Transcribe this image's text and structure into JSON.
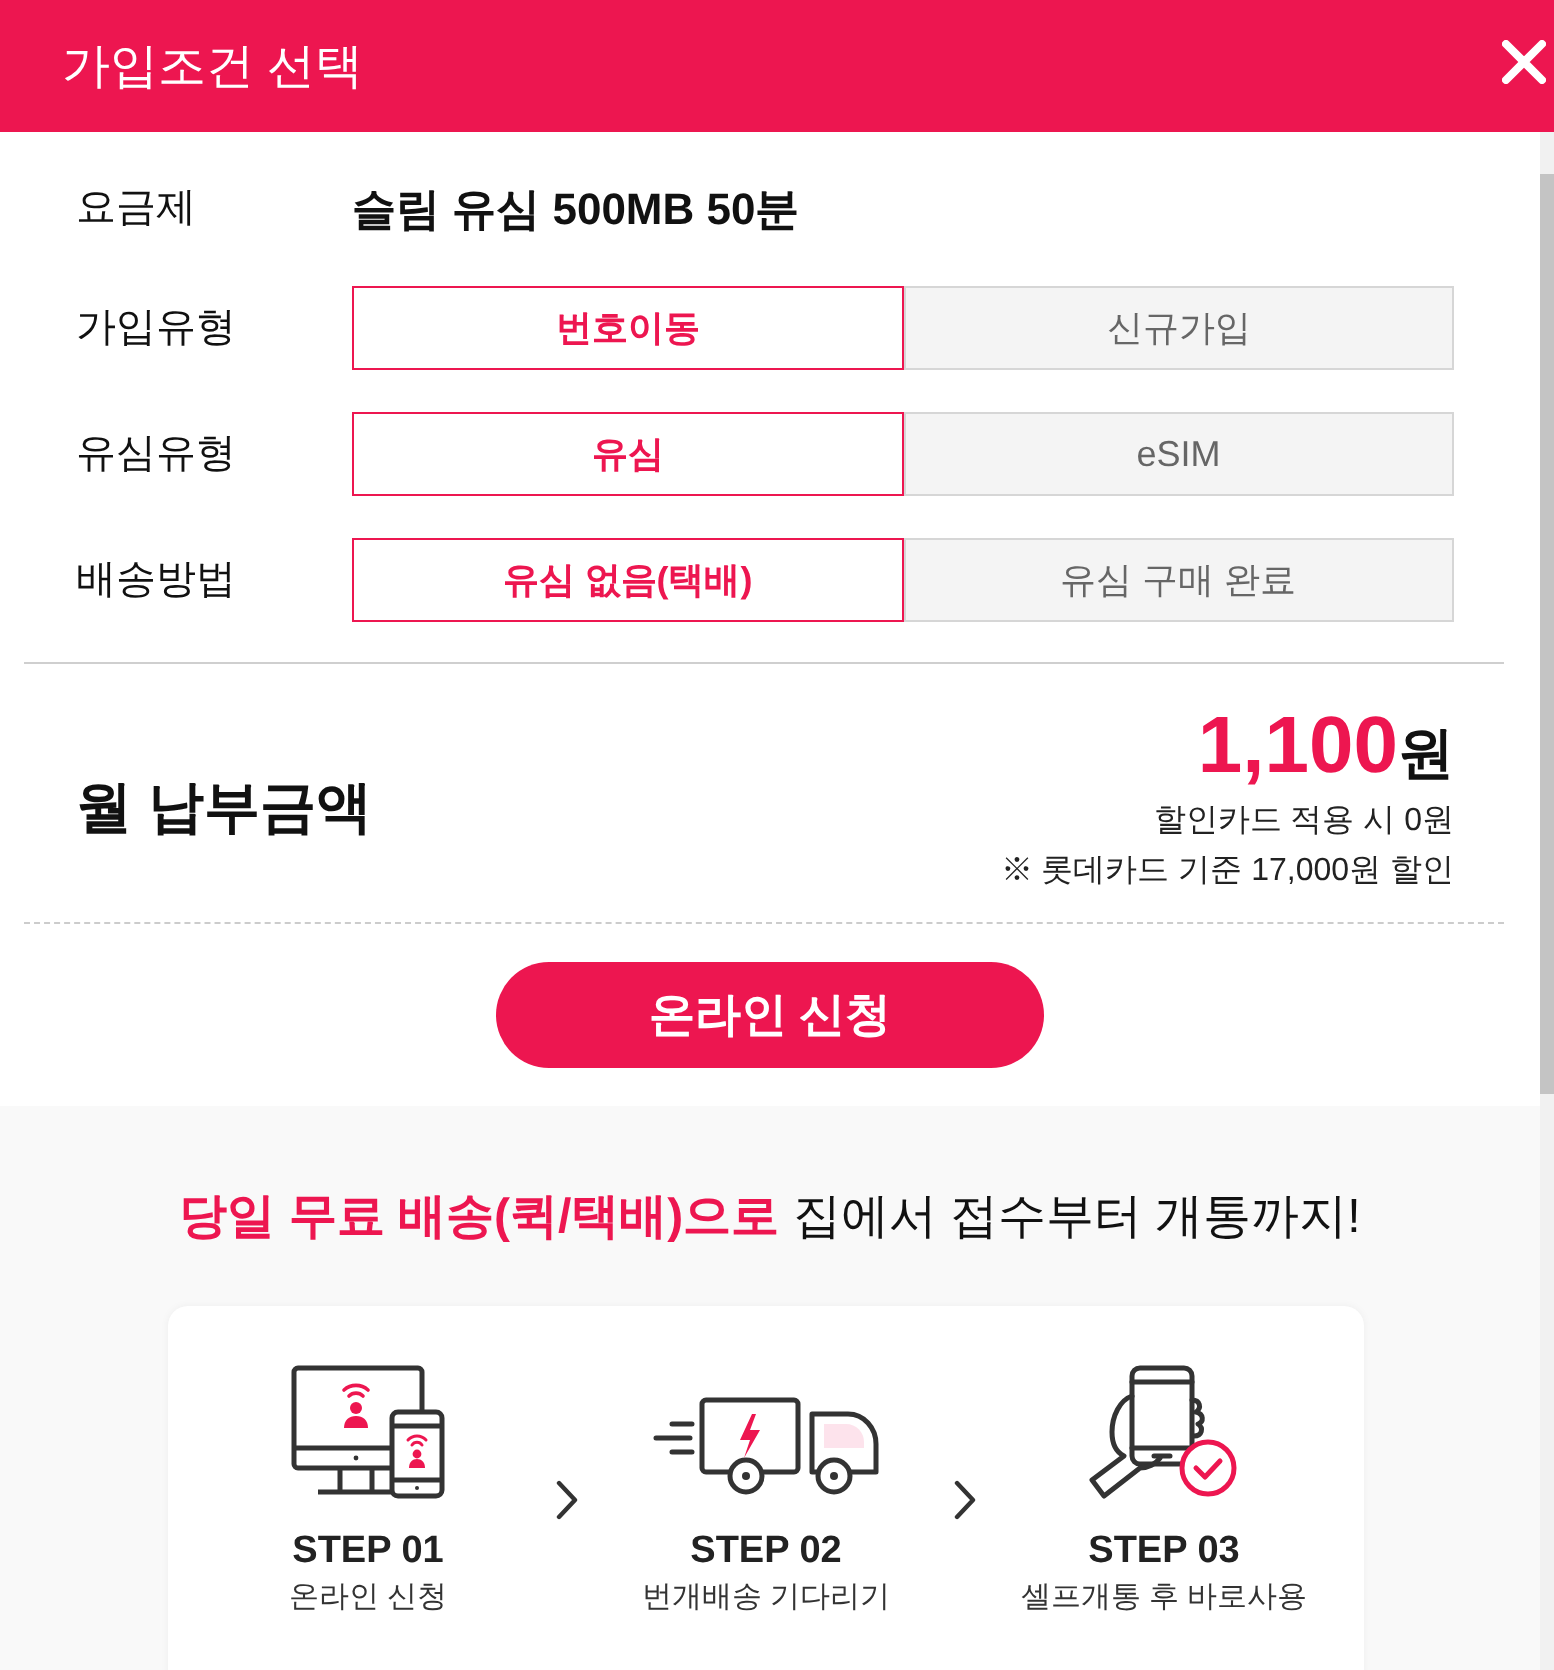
{
  "header": {
    "title": "가입조건 선택"
  },
  "plan": {
    "label": "요금제",
    "value": "슬림 유심 500MB 50분"
  },
  "options": [
    {
      "label": "가입유형",
      "choices": [
        {
          "label": "번호이동",
          "selected": true
        },
        {
          "label": "신규가입",
          "selected": false
        }
      ]
    },
    {
      "label": "유심유형",
      "choices": [
        {
          "label": "유심",
          "selected": true
        },
        {
          "label": "eSIM",
          "selected": false
        }
      ]
    },
    {
      "label": "배송방법",
      "choices": [
        {
          "label": "유심 없음(택배)",
          "selected": true
        },
        {
          "label": "유심 구매 완료",
          "selected": false
        }
      ]
    }
  ],
  "payment": {
    "label": "월 납부금액",
    "amount": "1,100",
    "unit": "원",
    "notes": [
      "할인카드 적용 시 0원",
      "※ 롯데카드 기준 17,000원 할인"
    ]
  },
  "apply_button": "온라인 신청",
  "delivery": {
    "headline": "**당일 무료 배송(퀵/택배)으로** 집에서 접수부터 개통까지!",
    "steps": [
      {
        "kind": "devices",
        "title": "STEP 01",
        "caption": "온라인 신청"
      },
      {
        "kind": "truck",
        "title": "STEP 02",
        "caption": "번개배송 기다리기"
      },
      {
        "kind": "phone",
        "title": "STEP 03",
        "caption": "셀프개통 후 바로사용"
      }
    ]
  }
}
